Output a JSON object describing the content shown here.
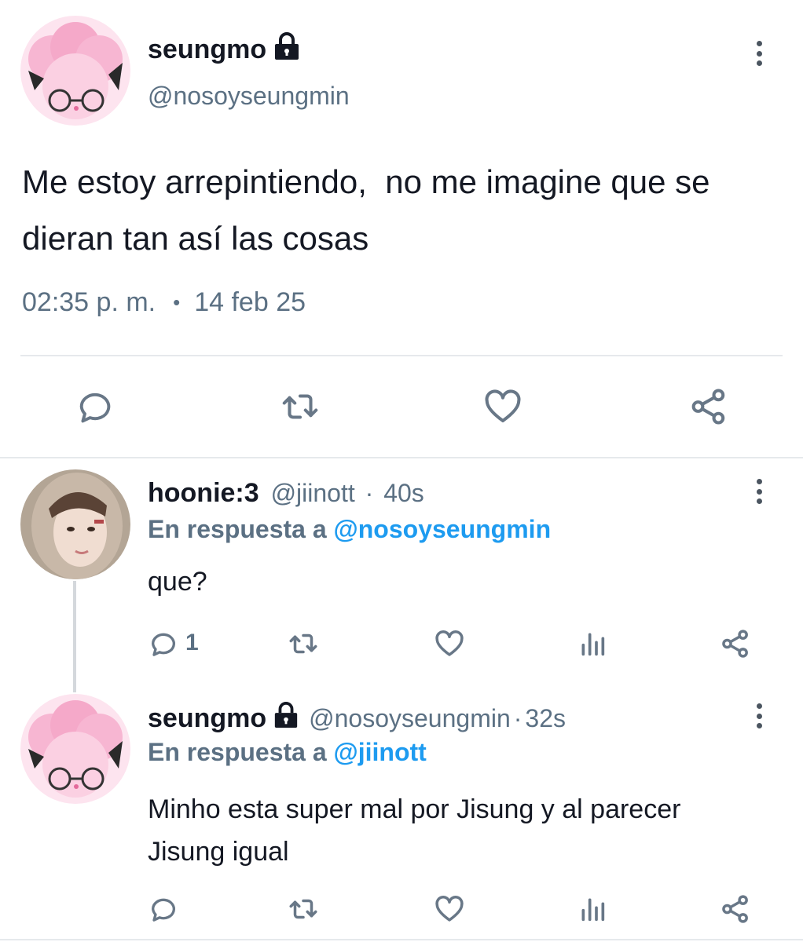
{
  "main_tweet": {
    "display_name": "seungmo",
    "handle": "@nosoyseungmin",
    "text_line1": "Me estoy arrepintiendo,  no me imagine que se",
    "text_line2": "dieran tan así las cosas",
    "time": "02:35 p. m.",
    "separator": "•",
    "date": "14 feb 25"
  },
  "reply1": {
    "display_name": "hoonie:3",
    "handle": "@jiinott",
    "dot": "·",
    "age": "40s",
    "reply_prefix": "En respuesta a",
    "reply_mention": "@nosoyseungmin",
    "text": "que?",
    "reply_count": "1"
  },
  "reply2": {
    "display_name": "seungmo",
    "handle": "@nosoyseungmin",
    "dot": "·",
    "age": "32s",
    "reply_prefix": "En respuesta a",
    "reply_mention": "@jiinott",
    "text_line1": "Minho esta super mal por Jisung y al parecer",
    "text_line2": "Jisung igual"
  },
  "colors": {
    "link": "#1d9bf0",
    "secondary_text": "#5b7083",
    "icon": "#687787",
    "divider": "#e6e9ec",
    "avatar_pink": "#f7b6d2"
  },
  "icons": [
    "lock-icon",
    "more-options-icon",
    "reply-icon",
    "retweet-icon",
    "like-icon",
    "share-icon",
    "analytics-icon"
  ]
}
